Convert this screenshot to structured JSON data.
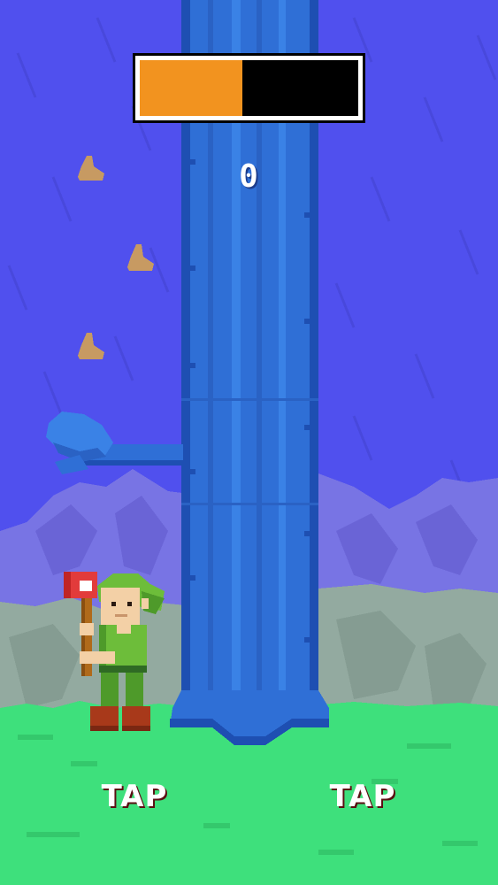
{
  "hud": {
    "score": "0",
    "time_remaining_fraction": 0.47
  },
  "controls": {
    "left_label": "TAP",
    "right_label": "TAP"
  },
  "scene": {
    "branch_side": "left",
    "player_side": "left",
    "weather": "rain",
    "falling_leaves": 3
  },
  "colors": {
    "sky": "#5050ee",
    "trunk": "#2f6fd6",
    "timer_fill": "#f2931f",
    "grass": "#3ee07c",
    "button": "#d42a33"
  }
}
